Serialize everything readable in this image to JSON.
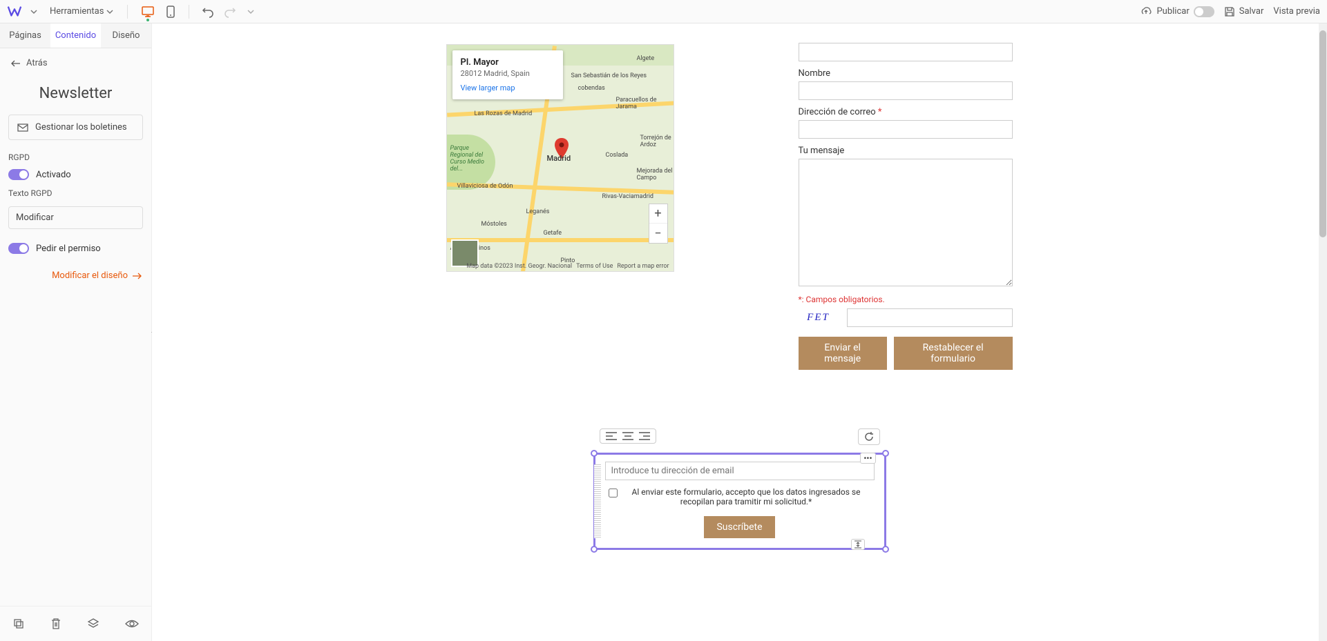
{
  "topbar": {
    "tools_label": "Herramientas",
    "publish_label": "Publicar",
    "save_label": "Salvar",
    "preview_label": "Vista previa"
  },
  "sidebar": {
    "tabs": {
      "pages": "Páginas",
      "content": "Contenido",
      "design": "Diseño"
    },
    "back_label": "Atrás",
    "title": "Newsletter",
    "manage_btn": "Gestionar los boletines",
    "gdpr_label": "RGPD",
    "gdpr_enabled": "Activado",
    "gdpr_text_label": "Texto RGPD",
    "modify_label": "Modificar",
    "ask_permission": "Pedir el permiso",
    "modify_design": "Modificar el diseño"
  },
  "map": {
    "place_title": "Pl. Mayor",
    "place_subtitle": "28012 Madrid, Spain",
    "view_larger": "View larger map",
    "center_label": "Madrid",
    "attrib_data": "Map data ©2023 Inst. Geogr. Nacional",
    "attrib_terms": "Terms of Use",
    "attrib_report": "Report a map error",
    "cities": {
      "algete": "Algete",
      "cobendas": "cobendas",
      "paracuellos": "Paracuellos de Jarama",
      "sansebastian": "San Sebastián de los Reyes",
      "rozas": "Las Rozas de Madrid",
      "torrejon": "Torrejón de Ardoz",
      "coslada": "Coslada",
      "rivas": "Rivas-Vaciamadrid",
      "mejorada": "Mejorada del Campo",
      "villaviciosa": "Villaviciosa de Odón",
      "mostoles": "Móstoles",
      "leganes": "Leganés",
      "getafe": "Getafe",
      "arroyomolinos": "Arroyomolinos",
      "pinto": "Pinto",
      "parque": "Parque Regional del Curso Medio del..."
    }
  },
  "form": {
    "name_label": "Nombre",
    "email_label": "Dirección de correo",
    "message_label": "Tu mensaje",
    "required_note": "*: Campos obligatorios.",
    "captcha_text": "FET",
    "submit_label": "Enviar el mensaje",
    "reset_label": "Restablecer el formulario"
  },
  "newsletter": {
    "email_placeholder": "Introduce tu dirección de email",
    "consent_text": "Al enviar este formulario, accepto que los datos ingresados se recopilan para tramitir mi solicitud.*",
    "subscribe_label": "Suscríbete"
  }
}
